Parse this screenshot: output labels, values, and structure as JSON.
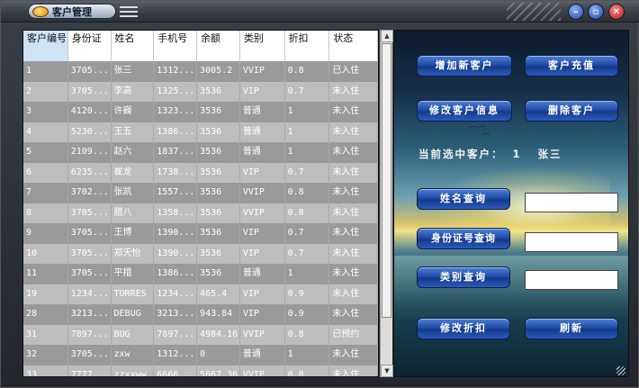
{
  "window": {
    "title": "客户管理",
    "accent": "#1f4da8"
  },
  "table": {
    "headers": [
      "客户编号",
      "身份证",
      "姓名",
      "手机号",
      "余额",
      "类别",
      "折扣",
      "状态"
    ],
    "rows": [
      [
        "1",
        "3705...",
        "张三",
        "1312...",
        "3005.2",
        "VVIP",
        "0.8",
        "已入住"
      ],
      [
        "2",
        "3705...",
        "李高",
        "1325...",
        "3536",
        "VIP",
        "0.7",
        "未入住"
      ],
      [
        "3",
        "4120...",
        "许巍",
        "1323...",
        "3536",
        "普通",
        "1",
        "未入住"
      ],
      [
        "4",
        "5230...",
        "王五",
        "1386...",
        "3536",
        "普通",
        "1",
        "未入住"
      ],
      [
        "5",
        "2109...",
        "赵六",
        "1837...",
        "3536",
        "普通",
        "1",
        "未入住"
      ],
      [
        "6",
        "6235...",
        "崔龙",
        "1738...",
        "3536",
        "VIP",
        "0.7",
        "未入住"
      ],
      [
        "7",
        "3702...",
        "张凯",
        "1557...",
        "3536",
        "VVIP",
        "0.8",
        "未入住"
      ],
      [
        "8",
        "3705...",
        "腊八",
        "1358...",
        "3536",
        "VVIP",
        "0.8",
        "未入住"
      ],
      [
        "9",
        "3705...",
        "王博",
        "1390...",
        "3536",
        "VIP",
        "0.7",
        "未入住"
      ],
      [
        "10",
        "3705...",
        "郑天怡",
        "1390...",
        "3536",
        "VIP",
        "0.7",
        "未入住"
      ],
      [
        "11",
        "3705...",
        "平措",
        "1386...",
        "3536",
        "普通",
        "1",
        "未入住"
      ],
      [
        "19",
        "1234...",
        "TORRES",
        "1234...",
        "465.4",
        "VIP",
        "0.9",
        "未入住"
      ],
      [
        "28",
        "3213...",
        "DEBUG",
        "3213...",
        "943.84",
        "VIP",
        "0.9",
        "未入住"
      ],
      [
        "31",
        "7897...",
        "BUG",
        "7897...",
        "4984.16",
        "VVIP",
        "0.8",
        "已预约"
      ],
      [
        "32",
        "3705...",
        "zxw",
        "1312...",
        "0",
        "普通",
        "1",
        "未入住"
      ],
      [
        "33",
        "7777...",
        "zzxxww",
        "6666...",
        "5667.36",
        "VVIP",
        "0.8",
        "未入住"
      ]
    ]
  },
  "actions": {
    "add_customer": "增加新客户",
    "recharge": "客户充值",
    "edit_customer": "修改客户信息",
    "delete_customer": "删除客户",
    "name_query": "姓名查询",
    "id_query": "身份证号查询",
    "category_query": "类别查询",
    "edit_discount": "修改折扣",
    "refresh": "刷新"
  },
  "selection": {
    "label": "当前选中客户：",
    "id": "1",
    "name": "张三"
  },
  "fields": {
    "name_value": "",
    "id_value": "",
    "category_value": ""
  }
}
